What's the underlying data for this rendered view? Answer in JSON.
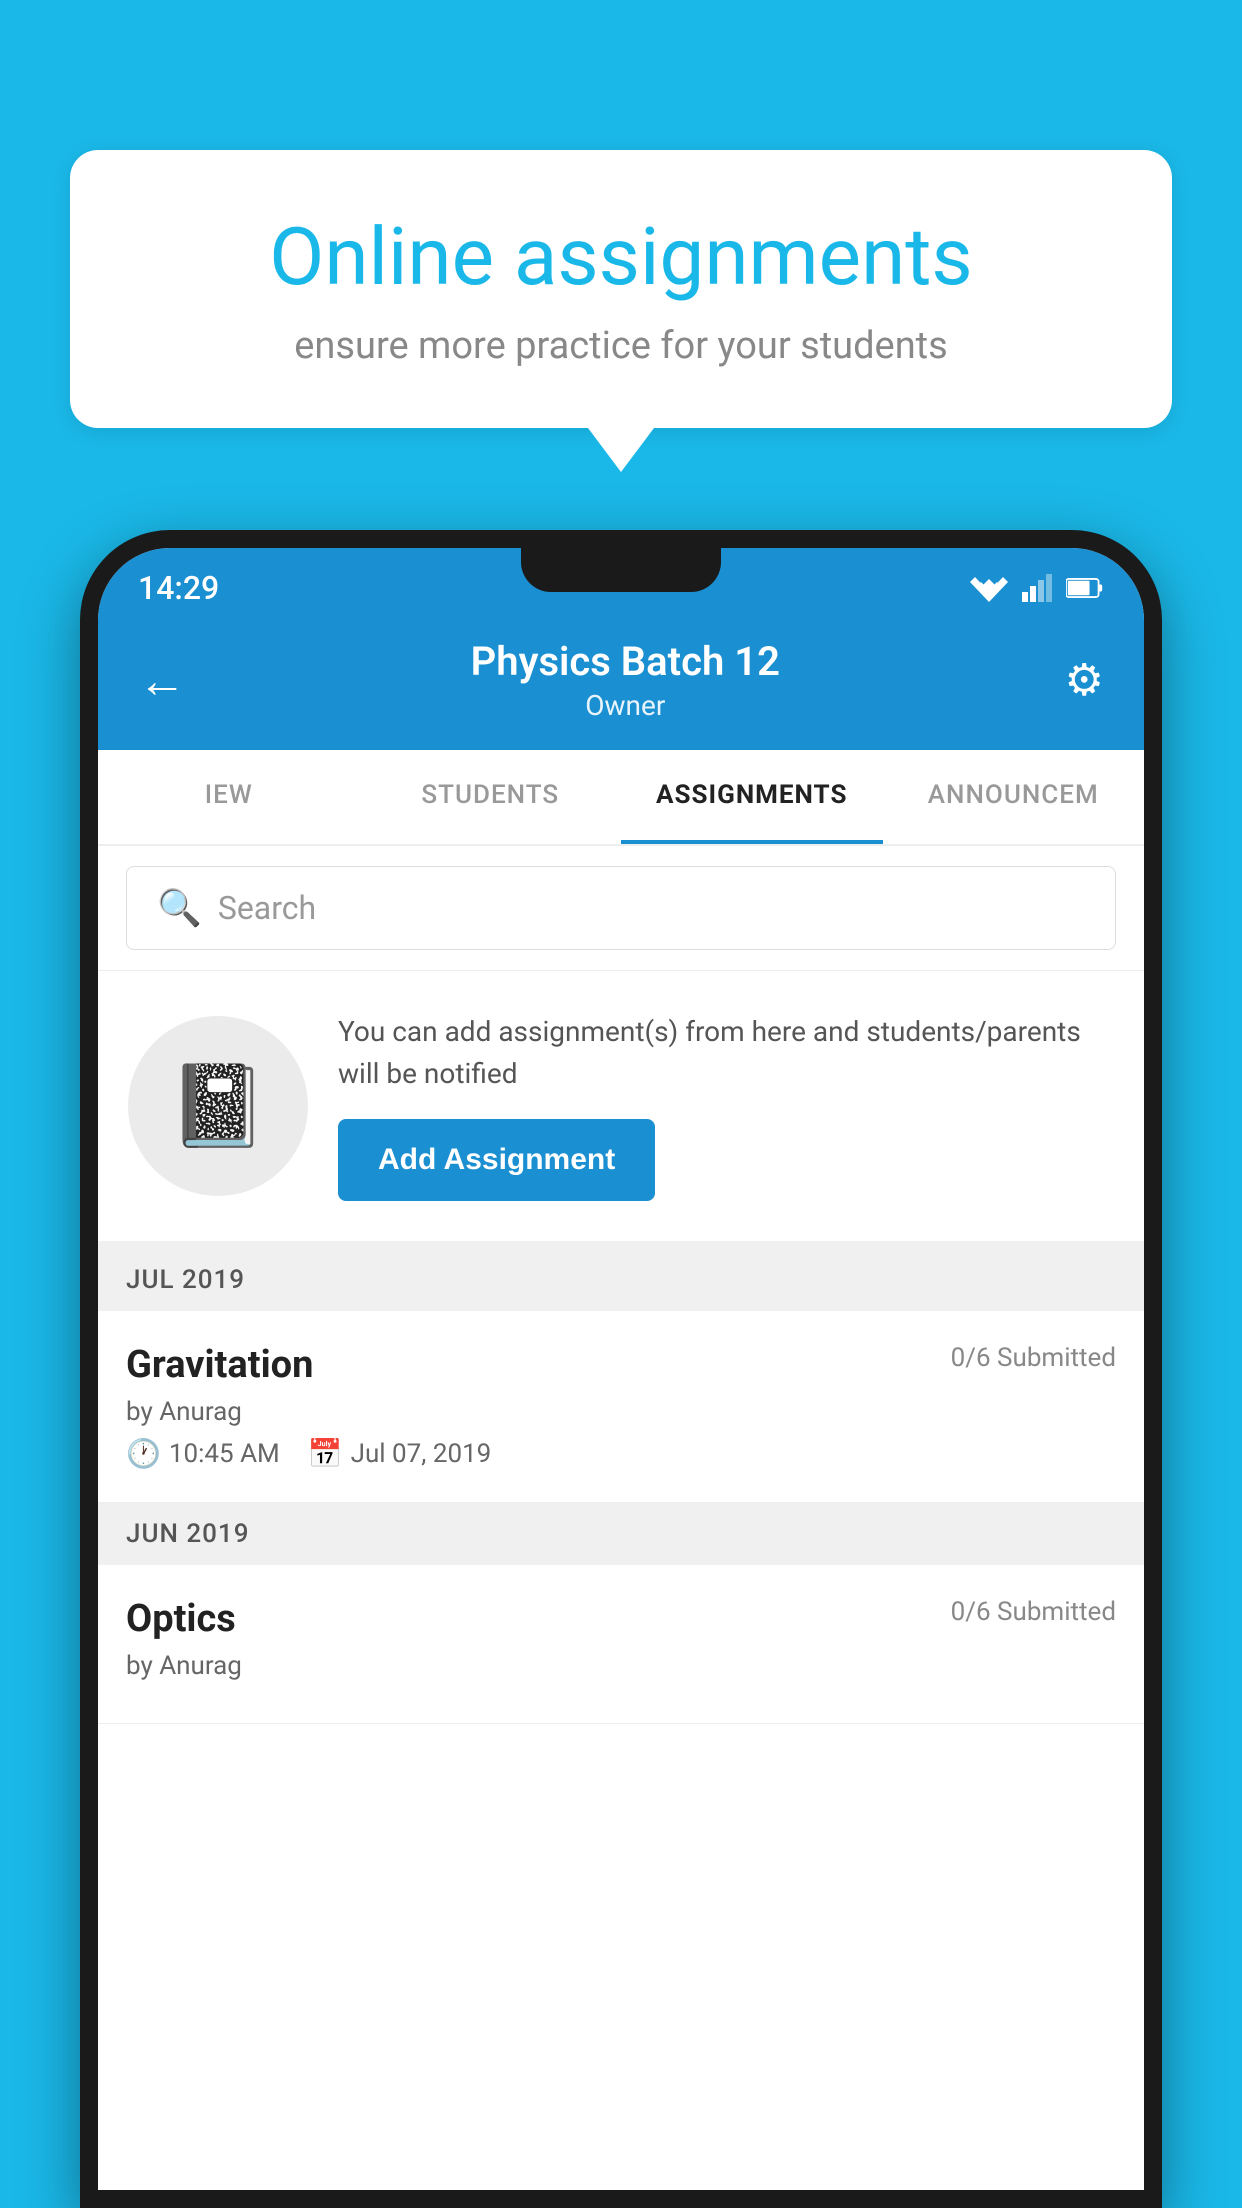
{
  "background_color": "#1ab8e8",
  "speech_bubble": {
    "title": "Online assignments",
    "subtitle": "ensure more practice for your students"
  },
  "status_bar": {
    "time": "14:29",
    "wifi": "▼",
    "signal": "▲",
    "battery": "▮"
  },
  "header": {
    "title": "Physics Batch 12",
    "subtitle": "Owner",
    "back_label": "←",
    "gear_label": "⚙"
  },
  "tabs": [
    {
      "label": "IEW",
      "active": false
    },
    {
      "label": "STUDENTS",
      "active": false
    },
    {
      "label": "ASSIGNMENTS",
      "active": true
    },
    {
      "label": "ANNOUNCEM",
      "active": false
    }
  ],
  "search": {
    "placeholder": "Search"
  },
  "promo": {
    "description": "You can add assignment(s) from here and students/parents will be notified",
    "button_label": "Add Assignment"
  },
  "months": [
    {
      "label": "JUL 2019",
      "assignments": [
        {
          "title": "Gravitation",
          "submitted": "0/6 Submitted",
          "author": "by Anurag",
          "time": "10:45 AM",
          "date": "Jul 07, 2019"
        }
      ]
    },
    {
      "label": "JUN 2019",
      "assignments": [
        {
          "title": "Optics",
          "submitted": "0/6 Submitted",
          "author": "by Anurag",
          "time": "",
          "date": ""
        }
      ]
    }
  ]
}
